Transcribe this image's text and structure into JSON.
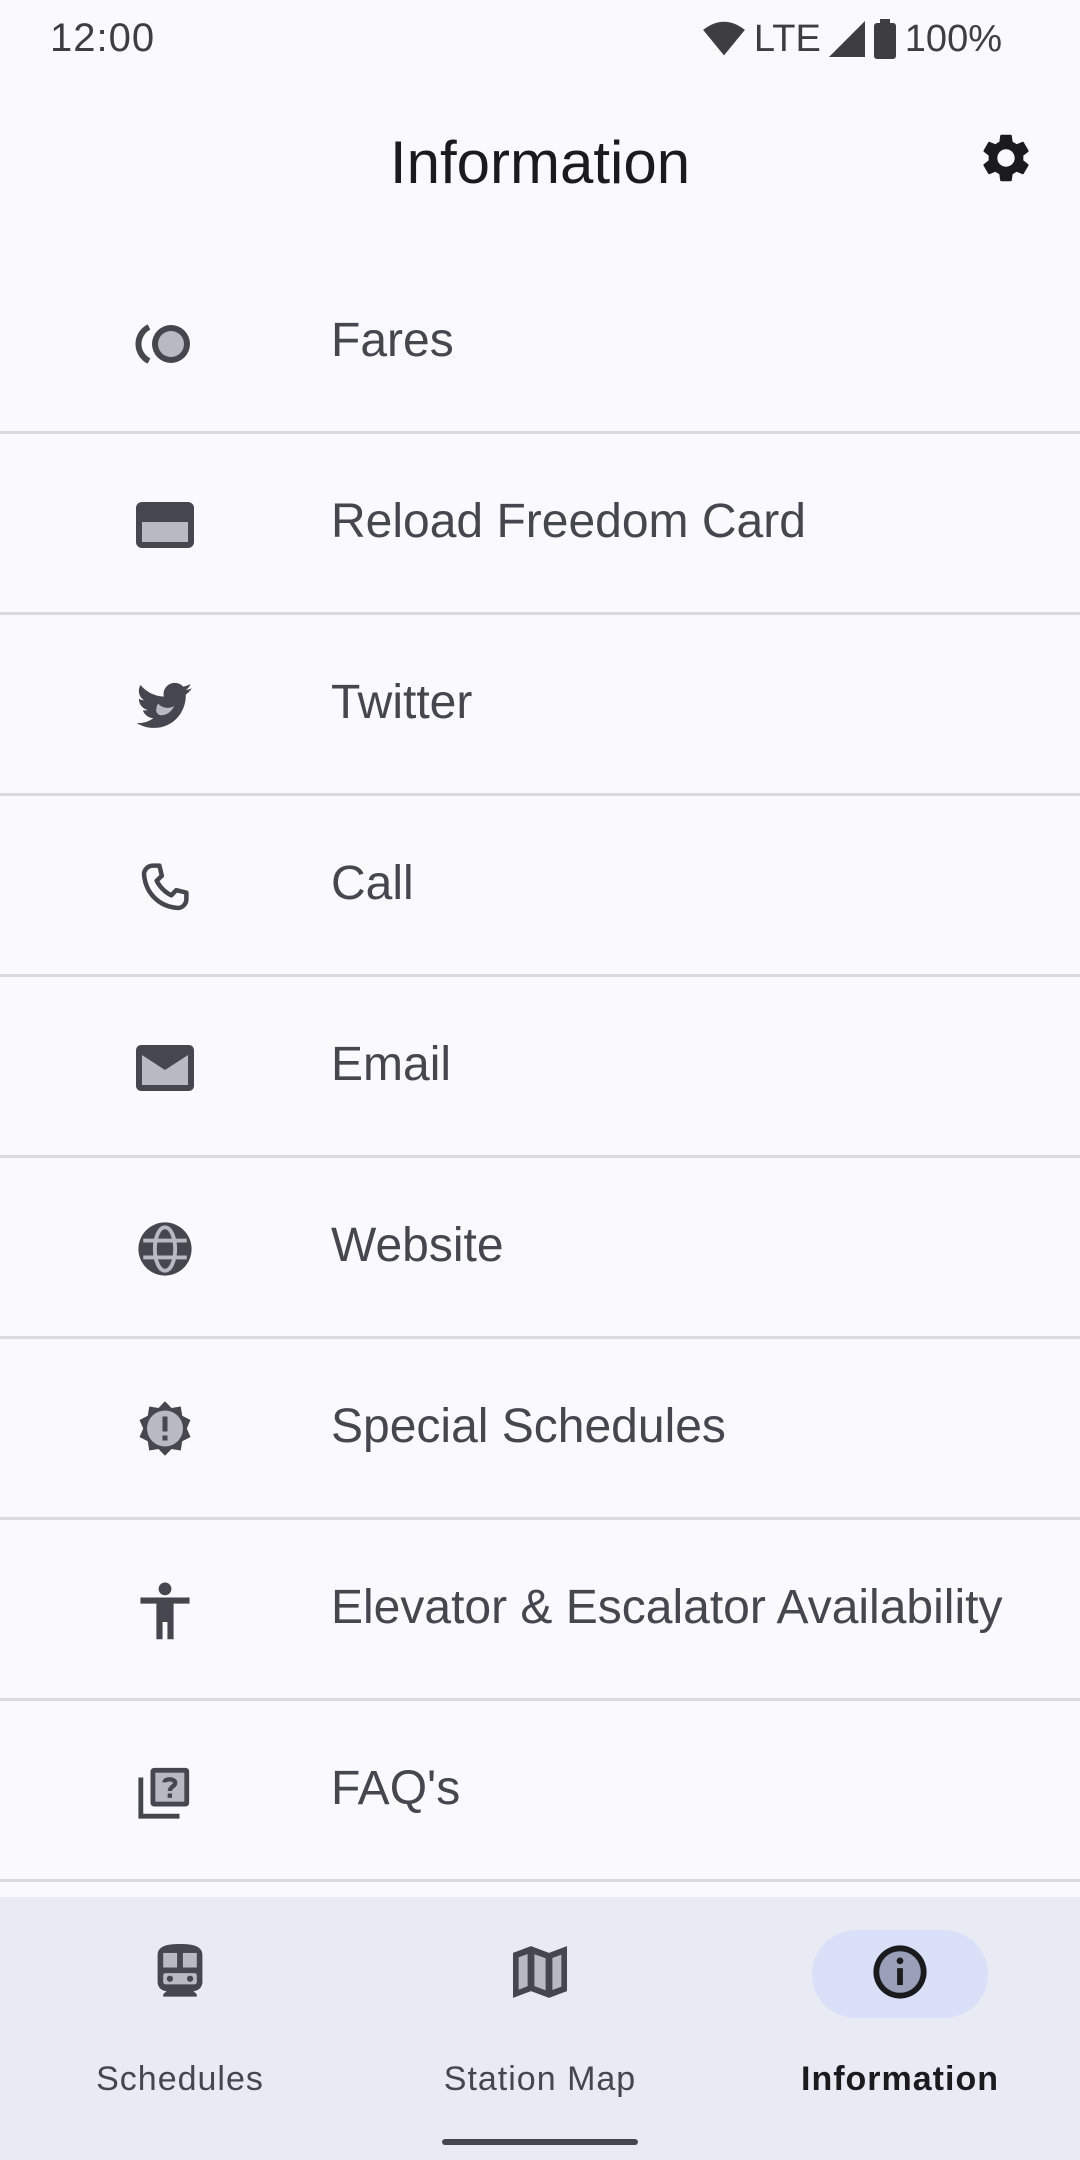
{
  "status_bar": {
    "time": "12:00",
    "network": "LTE",
    "battery": "100%",
    "icons": [
      "wifi-icon",
      "signal-icon",
      "battery-icon"
    ]
  },
  "header": {
    "title": "Information",
    "settings_icon": "gear-icon"
  },
  "list": {
    "items": [
      {
        "label": "Fares",
        "icon": "coins-icon"
      },
      {
        "label": "Reload Freedom Card",
        "icon": "credit-card-icon"
      },
      {
        "label": "Twitter",
        "icon": "twitter-bird-icon"
      },
      {
        "label": "Call",
        "icon": "phone-icon"
      },
      {
        "label": "Email",
        "icon": "envelope-icon"
      },
      {
        "label": "Website",
        "icon": "globe-icon"
      },
      {
        "label": "Special Schedules",
        "icon": "alert-badge-icon"
      },
      {
        "label": "Elevator & Escalator Availability",
        "icon": "accessibility-icon"
      },
      {
        "label": "FAQ's",
        "icon": "question-library-icon"
      }
    ]
  },
  "bottom_nav": {
    "items": [
      {
        "label": "Schedules",
        "icon": "train-icon",
        "active": false
      },
      {
        "label": "Station Map",
        "icon": "map-icon",
        "active": false
      },
      {
        "label": "Information",
        "icon": "info-icon",
        "active": true
      }
    ]
  },
  "colors": {
    "background": "#f9f9fe",
    "nav_background": "#e8eaf4",
    "active_indicator": "#d9e0f8",
    "text_primary": "#1b1b1f",
    "text_secondary": "#45464e",
    "divider": "#d9d9de"
  }
}
